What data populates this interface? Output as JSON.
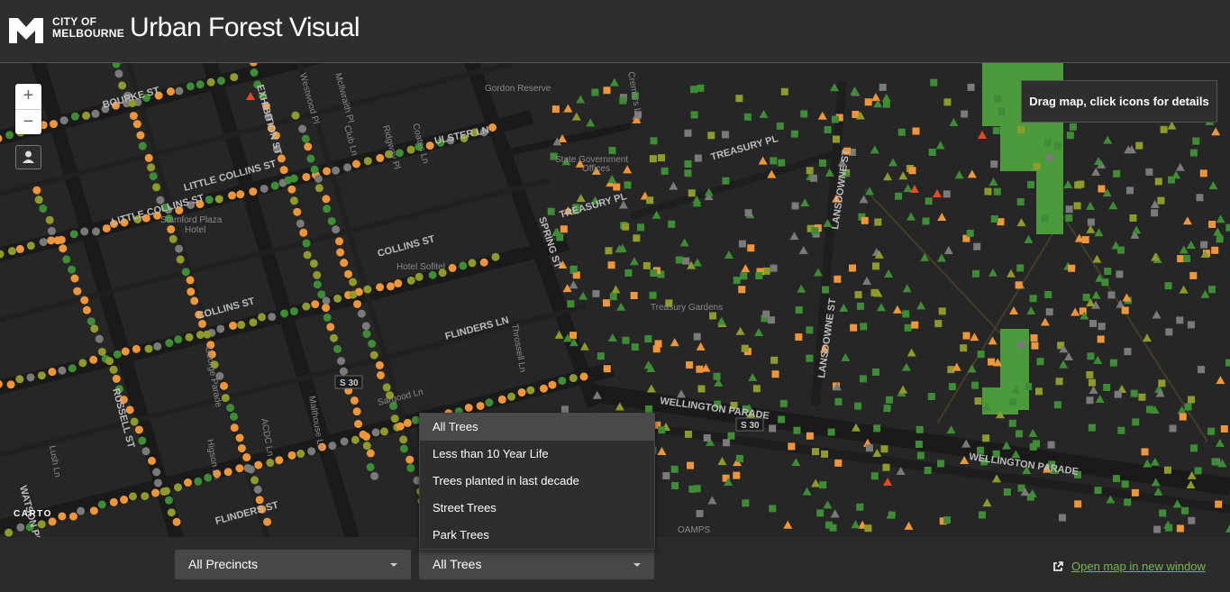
{
  "header": {
    "logo_line1": "CITY OF",
    "logo_line2": "MELBOURNE",
    "title": "Urban Forest Visual"
  },
  "map": {
    "tooltip": "Drag map, click icons for details",
    "attribution": "CARTO",
    "zoom_in": "+",
    "zoom_out": "−",
    "labels": {
      "bourke_st": "BOURKE ST",
      "little_collins_1": "LITTLE COLLINS ST",
      "little_collins_2": "LITTLE COLLINS ST",
      "collins_st_1": "COLLINS ST",
      "collins_st_2": "COLLINS ST",
      "flinders_ln": "FLINDERS LN",
      "flinders_st": "FLINDERS ST",
      "russell_st": "RUSSELL ST",
      "exhibition_st": "EXHIBITION ST",
      "spring_st": "SPRING ST",
      "wellington_parade_1": "WELLINGTON PARADE",
      "wellington_parade_2": "WELLINGTON PARADE",
      "treasury_pl_1": "TREASURY PL",
      "treasury_pl_2": "TREASURY PL",
      "lansdowne_st_1": "LANSDOWNE ST",
      "lansdowne_st_2": "LANSDOWNE ST",
      "ulster_ln": "ULSTER LN",
      "state_gov_1": "State Government",
      "state_gov_2": "Offices",
      "stamford_1": "Stamford Plaza",
      "stamford_2": "Hotel",
      "hotel_sofitel": "Hotel Sofitel",
      "treasury_gardens": "Treasury Gardens",
      "gordon_reserve": "Gordon Reserve",
      "s30_1": "S 30",
      "s30_2": "S 30",
      "oamps": "OAMPS",
      "watson_pl": "WATSON PL",
      "george_parade": "George Parade",
      "higson_ln": "Higson Ln",
      "throssell_ln": "Throssell Ln",
      "malthouse_ln": "Malthouse Ln",
      "sargood_ln": "Sargood Ln",
      "acdc_ln": "ACDC Ln",
      "lush_ln": "Lush Ln",
      "mcilwraith_pl": "McIlwraith Pl",
      "club_ln": "Club Ln",
      "ridgway_pl": "Ridgway Pl",
      "coates_ln": "Coates Ln",
      "westwood_pl": "Westwood Pl",
      "cremers_ln": "Cremers Ln"
    }
  },
  "dropdown": {
    "options": [
      "All Trees",
      "Less than 10 Year Life",
      "Trees planted in last decade",
      "Street Trees",
      "Park Trees"
    ],
    "highlighted": "All Trees"
  },
  "footer": {
    "precinct_select": "All Precincts",
    "tree_select": "All Trees",
    "open_link": "Open map in new window"
  },
  "colors": {
    "tree_green": "#3f8c36",
    "tree_olive": "#8f9a2b",
    "tree_orange": "#f0963a",
    "tree_red": "#e24a1f",
    "tree_grey": "#7a7a7a",
    "park_fill": "#4b9a3c",
    "link_green": "#7ab64e"
  }
}
